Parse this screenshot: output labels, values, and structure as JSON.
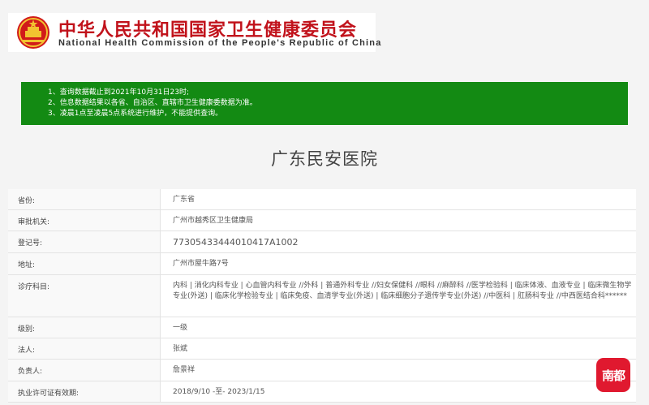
{
  "header": {
    "title_cn": "中华人民共和国国家卫生健康委员会",
    "title_en": "National Health Commission of the People's Republic of China"
  },
  "notice": {
    "lines": [
      "1、查询数据截止到2021年10月31日23时;",
      "2、信息数据结果以各省、自治区、直辖市卫生健康委数据为准。",
      "3、凌晨1点至凌晨5点系统进行维护，不能提供查询。"
    ]
  },
  "hospital_name": "广东民安医院",
  "rows": [
    {
      "label": "省份:",
      "value": "广东省"
    },
    {
      "label": "审批机关:",
      "value": "广州市越秀区卫生健康局"
    },
    {
      "label": "登记号:",
      "value": "77305433444010417A1002"
    },
    {
      "label": "地址:",
      "value": "广州市屋牛路7号"
    },
    {
      "label": "诊疗科目:",
      "value": "内科 | 消化内科专业 | 心血管内科专业 //外科 | 普通外科专业 //妇女保健科 //眼科 //麻醉科 //医学检验科 | 临床体液、血液专业 | 临床微生物学专业(外送) | 临床化学检验专业 | 临床免疫、血清学专业(外送) | 临床细胞分子遗传学专业(外送) //中医科 | 肛肠科专业 //中西医结合科******"
    },
    {
      "label": "级别:",
      "value": "一级"
    },
    {
      "label": "法人:",
      "value": "张斌"
    },
    {
      "label": "负责人:",
      "value": "詹景祥"
    },
    {
      "label": "执业许可证有效期:",
      "value": "2018/9/10 -至- 2023/1/15"
    }
  ],
  "badge": "南都",
  "colors": {
    "brand_red": "#c1121b",
    "notice_green": "#138a13",
    "badge_red": "#e0192f"
  }
}
